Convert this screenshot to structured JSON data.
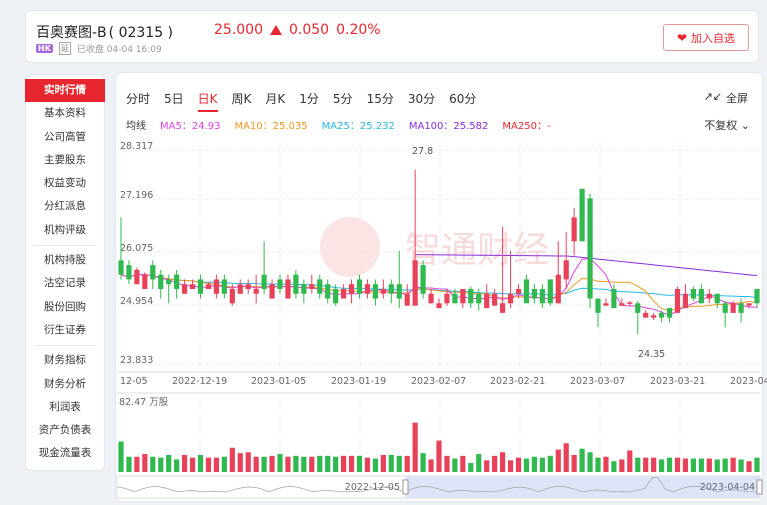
{
  "header": {
    "name": "百奥赛图-B",
    "code": "( 02315 )",
    "price": "25.000",
    "change": "0.050",
    "change_pct": "0.20%",
    "market": "HK",
    "delay": "延",
    "status": "已收盘 04-04 16:09",
    "fav_label": "加入自选"
  },
  "sidebar": {
    "groups": [
      [
        "实时行情",
        "基本资料",
        "公司高管",
        "主要股东",
        "权益变动",
        "分红派息",
        "机构评级"
      ],
      [
        "机构持股",
        "沽空记录",
        "股份回购",
        "衍生证券"
      ],
      [
        "财务指标",
        "财务分析",
        "利润表",
        "资产负债表",
        "现金流量表"
      ]
    ]
  },
  "tabs": [
    "分时",
    "5日",
    "日K",
    "周K",
    "月K",
    "1分",
    "5分",
    "15分",
    "30分",
    "60分"
  ],
  "fullscreen": "全屏",
  "ma_legend": {
    "label": "均线",
    "ma5": "MA5：24.93",
    "ma10": "MA10：25.035",
    "ma25": "MA25：25.232",
    "ma100": "MA100：25.582",
    "ma250": "MA250：-"
  },
  "adjust": "不复权",
  "watermark": "智通财经",
  "colors": {
    "up": "#e8415a",
    "down": "#2fb94f",
    "ma5": "#e040e0",
    "ma10": "#f0981e",
    "ma25": "#27b8e6",
    "ma100": "#8a2be2",
    "ma250": "#e8262f"
  },
  "chart_data": {
    "type": "candlestick",
    "y_ticks": [
      "28.317",
      "27.196",
      "26.075",
      "24.954",
      "23.833"
    ],
    "ylim": [
      23.833,
      28.317
    ],
    "x_ticks": [
      "12-05",
      "2022-12-19",
      "2023-01-05",
      "2023-01-19",
      "2023-02-07",
      "2023-02-21",
      "2023-03-07",
      "2023-03-21",
      "2023-04-04"
    ],
    "annotations": {
      "high": "27.8",
      "low": "24.35"
    },
    "ohlc": [
      [
        25.9,
        25.6,
        25.5,
        26.8
      ],
      [
        25.8,
        25.5,
        25.4,
        25.9
      ],
      [
        25.4,
        25.7,
        25.4,
        25.75
      ],
      [
        25.3,
        25.6,
        25.3,
        25.65
      ],
      [
        25.8,
        25.5,
        25.3,
        25.9
      ],
      [
        25.6,
        25.3,
        25.1,
        25.7
      ],
      [
        25.5,
        25.4,
        25.0,
        25.6
      ],
      [
        25.6,
        25.3,
        25.1,
        25.7
      ],
      [
        25.2,
        25.4,
        25.2,
        25.5
      ],
      [
        25.3,
        25.4,
        25.3,
        25.5
      ],
      [
        25.5,
        25.2,
        25.1,
        25.6
      ],
      [
        25.3,
        25.4,
        25.3,
        25.45
      ],
      [
        25.2,
        25.5,
        25.1,
        25.6
      ],
      [
        25.5,
        25.2,
        25.1,
        25.6
      ],
      [
        25.0,
        25.3,
        24.95,
        25.4
      ],
      [
        25.2,
        25.4,
        25.2,
        25.5
      ],
      [
        25.3,
        25.4,
        25.2,
        25.5
      ],
      [
        25.2,
        25.3,
        25.0,
        25.6
      ],
      [
        25.6,
        25.3,
        25.2,
        26.3
      ],
      [
        25.1,
        25.4,
        25.1,
        25.5
      ],
      [
        25.5,
        25.3,
        25.2,
        25.6
      ],
      [
        25.1,
        25.5,
        25.1,
        25.6
      ],
      [
        25.6,
        25.2,
        25.1,
        25.7
      ],
      [
        25.4,
        25.2,
        25.0,
        25.5
      ],
      [
        25.3,
        25.4,
        25.2,
        25.6
      ],
      [
        25.5,
        25.2,
        25.1,
        25.6
      ],
      [
        25.4,
        25.1,
        25.0,
        25.5
      ],
      [
        25.3,
        25.0,
        24.95,
        25.4
      ],
      [
        25.1,
        25.3,
        25.1,
        25.4
      ],
      [
        25.2,
        25.4,
        25.0,
        25.5
      ],
      [
        25.5,
        25.2,
        25.1,
        25.6
      ],
      [
        25.2,
        25.4,
        25.1,
        25.5
      ],
      [
        25.4,
        25.1,
        24.95,
        25.5
      ],
      [
        25.2,
        25.3,
        25.1,
        25.5
      ],
      [
        25.4,
        25.2,
        25.0,
        25.5
      ],
      [
        25.4,
        25.1,
        24.9,
        26.1
      ],
      [
        24.95,
        25.2,
        24.95,
        25.4
      ],
      [
        24.95,
        25.9,
        24.95,
        27.8
      ],
      [
        25.8,
        25.2,
        25.1,
        25.9
      ],
      [
        25.0,
        25.2,
        25.0,
        25.3
      ],
      [
        24.9,
        25.0,
        24.9,
        25.1
      ],
      [
        25.0,
        25.2,
        24.95,
        25.3
      ],
      [
        25.2,
        25.0,
        25.0,
        25.3
      ],
      [
        25.0,
        25.3,
        24.9,
        25.3
      ],
      [
        25.3,
        25.0,
        24.9,
        25.35
      ],
      [
        25.2,
        25.0,
        24.85,
        25.3
      ],
      [
        24.9,
        25.2,
        24.9,
        25.4
      ],
      [
        24.95,
        25.2,
        24.95,
        25.3
      ],
      [
        24.8,
        25.0,
        24.8,
        26.6
      ],
      [
        25.0,
        25.2,
        24.9,
        26.1
      ],
      [
        25.2,
        25.3,
        25.1,
        25.4
      ],
      [
        25.5,
        25.0,
        25.0,
        25.6
      ],
      [
        25.3,
        25.1,
        25.0,
        25.4
      ],
      [
        25.3,
        25.0,
        24.9,
        25.4
      ],
      [
        25.5,
        25.0,
        24.95,
        25.5
      ],
      [
        25.0,
        25.6,
        25.0,
        26.3
      ],
      [
        25.5,
        25.9,
        25.3,
        26.5
      ],
      [
        26.3,
        26.8,
        26.0,
        27.0
      ],
      [
        27.4,
        26.3,
        26.3,
        27.4
      ],
      [
        27.2,
        25.1,
        24.9,
        27.3
      ],
      [
        25.1,
        24.8,
        24.5,
        25.1
      ],
      [
        24.95,
        25.0,
        24.95,
        25.1
      ],
      [
        25.3,
        24.9,
        24.9,
        25.4
      ],
      [
        24.95,
        25.0,
        24.95,
        25.1
      ],
      [
        25.0,
        25.02,
        24.95,
        25.05
      ],
      [
        25.0,
        24.8,
        24.35,
        25.05
      ],
      [
        24.7,
        24.8,
        24.7,
        24.85
      ],
      [
        24.7,
        24.75,
        24.65,
        24.8
      ],
      [
        24.8,
        24.7,
        24.6,
        24.85
      ],
      [
        24.9,
        24.7,
        24.6,
        24.9
      ],
      [
        24.8,
        25.3,
        24.8,
        25.35
      ],
      [
        24.9,
        25.2,
        24.9,
        25.4
      ],
      [
        25.3,
        25.1,
        25.05,
        25.35
      ],
      [
        25.3,
        25.0,
        25.0,
        25.4
      ],
      [
        25.1,
        25.2,
        25.0,
        25.3
      ],
      [
        25.2,
        25.0,
        24.9,
        25.2
      ],
      [
        25.0,
        24.8,
        24.5,
        25.05
      ],
      [
        24.8,
        25.0,
        24.8,
        25.05
      ],
      [
        25.0,
        24.8,
        24.6,
        25.1
      ],
      [
        24.95,
        25.0,
        24.9,
        25.0
      ],
      [
        25.3,
        25.0,
        24.9,
        25.3
      ]
    ],
    "ma100": {
      "start_index": 37,
      "start": 26.02,
      "end": 25.58
    },
    "volume": {
      "label": "82.47 万股",
      "max": 82.47,
      "values": [
        34,
        17,
        17,
        20,
        17,
        16,
        19,
        14,
        19,
        16,
        19,
        16,
        16,
        17,
        27,
        21,
        22,
        17,
        17,
        18,
        20,
        17,
        18,
        17,
        17,
        18,
        18,
        17,
        18,
        18,
        18,
        16,
        15,
        19,
        19,
        18,
        18,
        55,
        21,
        14,
        35,
        18,
        15,
        18,
        10,
        20,
        13,
        18,
        22,
        13,
        16,
        15,
        17,
        16,
        18,
        25,
        32,
        19,
        26,
        22,
        16,
        17,
        12,
        14,
        24,
        16,
        16,
        16,
        14,
        16,
        16,
        15,
        15,
        15,
        15,
        14,
        15,
        16,
        14,
        12,
        16
      ]
    },
    "navigator": {
      "start": "2022-12-05",
      "end": "2023-04-04"
    }
  }
}
